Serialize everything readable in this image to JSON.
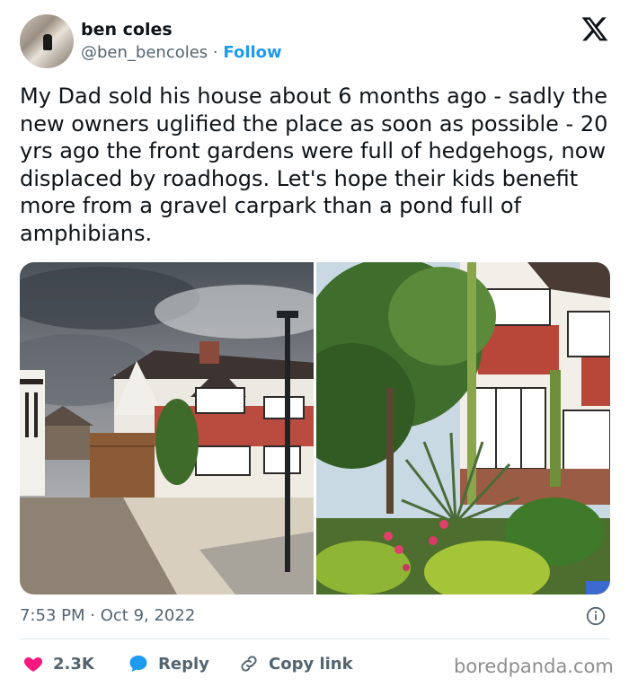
{
  "author": {
    "name": "ben coles",
    "handle": "@ben_bencoles",
    "separator": "·",
    "follow_label": "Follow"
  },
  "tweet": {
    "text": "My Dad sold his house about 6 months ago - sadly the new owners uglified the place as soon as possible - 20 yrs ago the front gardens were full of hedgehogs, now displaced by roadhogs. Let's hope their kids benefit more from a gravel carpark than a pond full of amphibians.",
    "time": "7:53 PM",
    "separator": "·",
    "date": "Oct 9, 2022"
  },
  "actions": {
    "likes": "2.3K",
    "reply_label": "Reply",
    "copy_label": "Copy link"
  },
  "icons": {
    "platform": "x-logo-icon",
    "info": "info-icon",
    "like": "heart-icon",
    "reply": "speech-bubble-icon",
    "copy": "link-icon"
  },
  "colors": {
    "accent": "#1d9bf0",
    "like": "#f91880",
    "muted": "#536471"
  },
  "watermark": "boredpanda.com"
}
